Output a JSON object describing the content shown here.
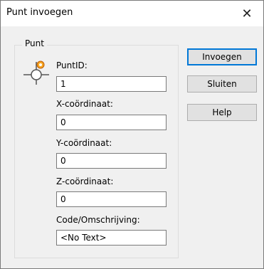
{
  "window": {
    "title": "Punt invoegen",
    "close_glyph": "✕"
  },
  "group": {
    "label": "Punt",
    "icon": "point-marker-icon"
  },
  "fields": {
    "puntid": {
      "label": "PuntID:",
      "value": "1"
    },
    "x": {
      "label": "X-coördinaat:",
      "value": "0"
    },
    "y": {
      "label": "Y-coördinaat:",
      "value": "0"
    },
    "z": {
      "label": "Z-coördinaat:",
      "value": "0"
    },
    "code": {
      "label": "Code/Omschrijving:",
      "value": "<No Text>"
    }
  },
  "buttons": {
    "insert": "Invoegen",
    "close": "Sluiten",
    "help": "Help"
  },
  "colors": {
    "dialog_bg": "#f0f0f0",
    "focus_border": "#0078d7",
    "icon_accent": "#f0a000"
  }
}
